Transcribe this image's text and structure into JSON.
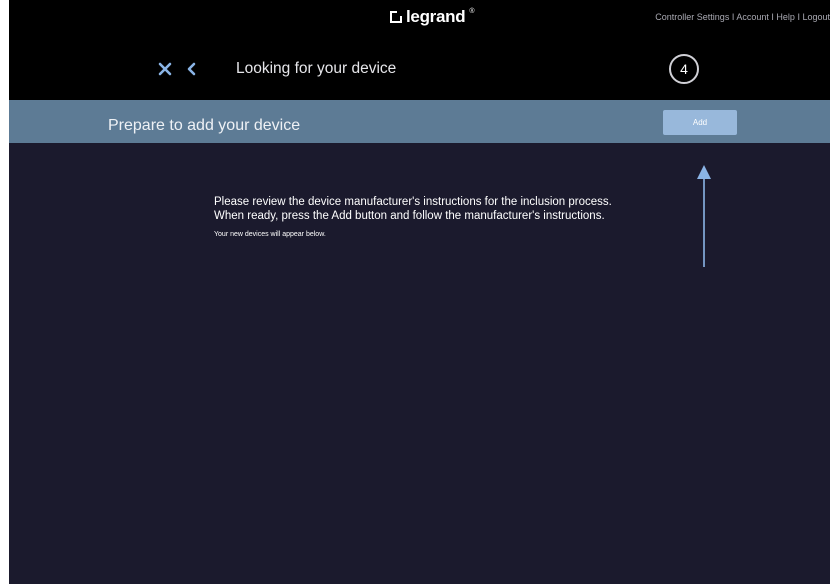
{
  "brand": {
    "logo_text": "legrand",
    "reg_mark": "®"
  },
  "top_links": [
    "Controller Settings",
    "Account",
    "Help",
    "Logout"
  ],
  "header": {
    "title": "Looking for your device",
    "step": "4"
  },
  "subbar": {
    "title": "Prepare to add your device",
    "add_label": "Add"
  },
  "main": {
    "line1": "Please review the device manufacturer's instructions for the inclusion process.",
    "line2": "When ready, press the Add button and follow the manufacturer's instructions.",
    "note": "Your new devices will appear below."
  },
  "colors": {
    "background": "#1b1a2d",
    "topbar": "#000000",
    "subbar": "#5d7b95",
    "accent": "#8ab4e6",
    "add_button": "#98b8db"
  },
  "icons": {
    "close": "close-icon",
    "back": "chevron-left-icon",
    "arrow": "arrow-up-icon"
  }
}
